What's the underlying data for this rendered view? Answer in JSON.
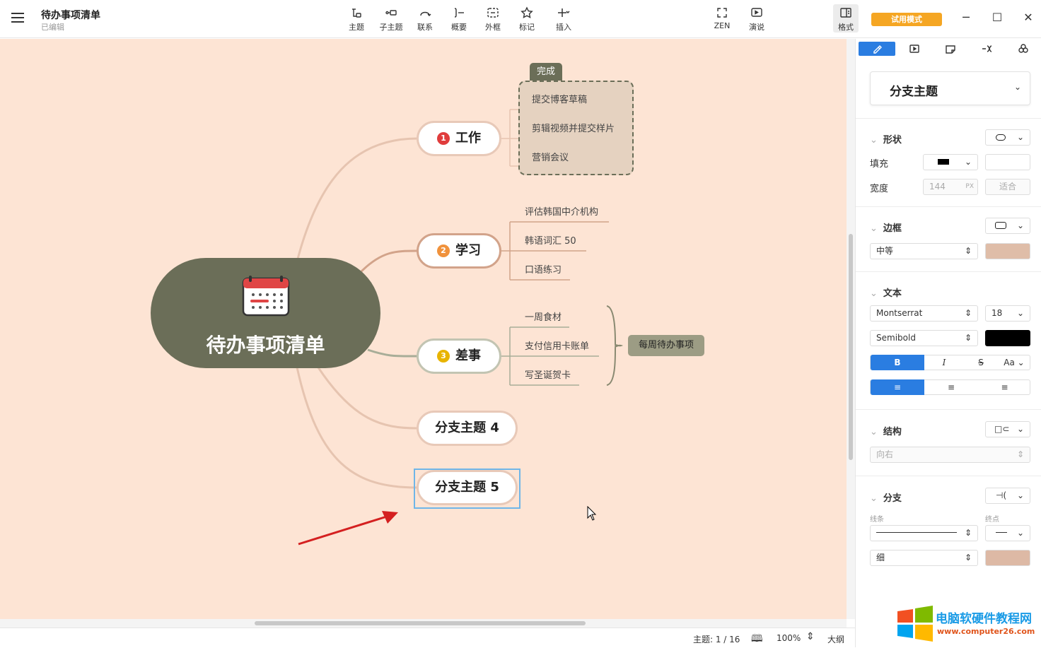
{
  "topbar": {
    "doc_title": "待办事项清单",
    "doc_status": "已编辑",
    "tools": [
      {
        "label": "主题",
        "icon": "topic-icon"
      },
      {
        "label": "子主题",
        "icon": "subtopic-icon"
      },
      {
        "label": "联系",
        "icon": "relationship-icon"
      },
      {
        "label": "概要",
        "icon": "summary-icon"
      },
      {
        "label": "外框",
        "icon": "boundary-icon"
      },
      {
        "label": "标记",
        "icon": "marker-icon"
      },
      {
        "label": "插入",
        "icon": "insert-icon"
      }
    ],
    "zen_label": "ZEN",
    "present_label": "演说",
    "format_label": "格式",
    "trial_label": "试用模式"
  },
  "mindmap": {
    "central": "待办事项清单",
    "branches": [
      {
        "num": "1",
        "label": "工作",
        "num_color": "#e03c3c"
      },
      {
        "num": "2",
        "label": "学习",
        "num_color": "#f0923c"
      },
      {
        "num": "3",
        "label": "差事",
        "num_color": "#e8b400"
      },
      {
        "label": "分支主题 4"
      },
      {
        "label": "分支主题 5"
      }
    ],
    "work_items": [
      "提交博客草稿",
      "剪辑视频并提交样片",
      "营销会议"
    ],
    "boundary_label": "完成",
    "study_items": [
      "评估韩国中介机构",
      "韩语词汇 50",
      "口语练习"
    ],
    "errand_items": [
      "一周食材",
      "支付信用卡账单",
      "写圣诞贺卡"
    ],
    "summary_label": "每周待办事项"
  },
  "status": {
    "topic_count": "主题: 1 / 16",
    "zoom": "100%",
    "outline": "大纲"
  },
  "panel": {
    "style_select": "分支主题",
    "shape_section": "形状",
    "fill_label": "填充",
    "width_label": "宽度",
    "width_value": "144",
    "width_unit": "PX",
    "fit_label": "适合",
    "border_section": "边框",
    "border_weight": "中等",
    "border_color": "#dfbda8",
    "text_section": "文本",
    "font_family": "Montserrat",
    "font_size": "18",
    "font_weight": "Semibold",
    "text_color": "#000000",
    "bold_label": "B",
    "italic_label": "I",
    "strike_label": "S",
    "case_label": "Aa",
    "structure_section": "结构",
    "structure_dir": "向右",
    "branch_section": "分支",
    "line_label": "线条",
    "end_label": "终点",
    "line_weight": "细",
    "branch_color": "#ddb9a5"
  },
  "watermark": {
    "title": "电脑软硬件教程网",
    "url": "www.computer26.com"
  },
  "colors": {
    "canvas_bg": "#fde4d4",
    "central_bg": "#6b6e58",
    "accent": "#2a7de1",
    "boundary_bg": "#e5d2c0",
    "summary_bg": "#9c9c84"
  }
}
